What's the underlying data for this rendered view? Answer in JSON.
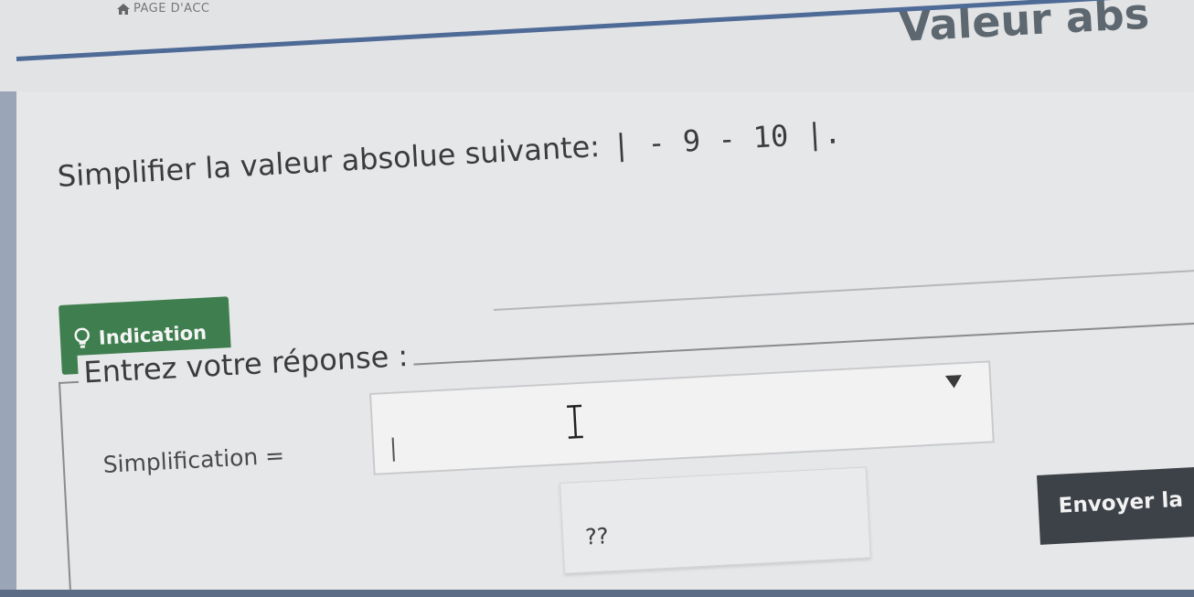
{
  "header": {
    "breadcrumb": "PAGE D'ACC",
    "title": "Valeur abs",
    "accent_color": "#4e6a96"
  },
  "question": {
    "prompt": "Simplifier la valeur absolue suivante:",
    "expression": "| - 9 - 10 |."
  },
  "hint": {
    "label": "Indication",
    "icon": "lightbulb-icon",
    "color": "#3f7f4f"
  },
  "answer": {
    "legend": "Entrez votre réponse :",
    "field_label": "Simplification =",
    "value": "",
    "placeholder": ""
  },
  "unknown": {
    "label": "??"
  },
  "submit": {
    "label": "Envoyer la",
    "color": "#3d4148"
  }
}
